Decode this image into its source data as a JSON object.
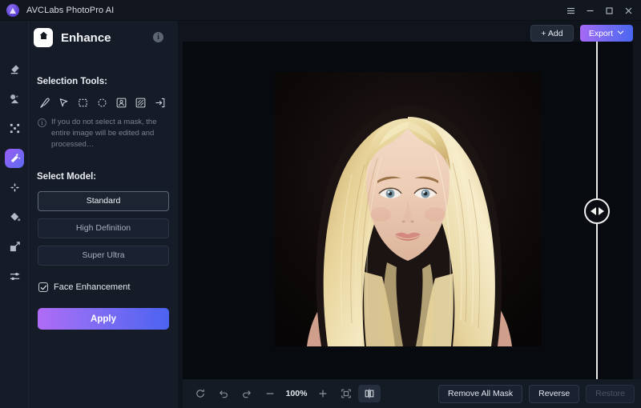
{
  "window": {
    "app_title": "AVCLabs PhotoPro AI",
    "logo_icon": "avclabs-logo",
    "controls": [
      {
        "name": "menu-button",
        "icon": "hamburger-icon"
      },
      {
        "name": "minimize-button",
        "icon": "minimize-icon"
      },
      {
        "name": "maximize-button",
        "icon": "maximize-icon"
      },
      {
        "name": "close-button",
        "icon": "close-icon"
      }
    ]
  },
  "rail": {
    "items": [
      {
        "name": "sidebar-item-erase",
        "icon": "eraser-icon",
        "active": false
      },
      {
        "name": "sidebar-item-background",
        "icon": "background-remove-icon",
        "active": false
      },
      {
        "name": "sidebar-item-upscale",
        "icon": "upscale-icon",
        "active": false
      },
      {
        "name": "sidebar-item-enhance",
        "icon": "magic-wand-icon",
        "active": true
      },
      {
        "name": "sidebar-item-retouch",
        "icon": "retouch-icon",
        "active": false
      },
      {
        "name": "sidebar-item-colorize",
        "icon": "paint-bucket-icon",
        "active": false
      },
      {
        "name": "sidebar-item-expand",
        "icon": "expand-icon",
        "active": false
      },
      {
        "name": "sidebar-item-adjust",
        "icon": "sliders-icon",
        "active": false
      }
    ]
  },
  "panel": {
    "home_icon": "home-icon",
    "title": "Enhance",
    "info_icon": "info-icon",
    "info_glyph": "i",
    "selection_tools_label": "Selection Tools:",
    "tools": [
      {
        "name": "tool-brush",
        "icon": "brush-icon"
      },
      {
        "name": "tool-lasso",
        "icon": "cursor-arrow-icon"
      },
      {
        "name": "tool-rectangle",
        "icon": "rectangle-marquee-icon"
      },
      {
        "name": "tool-ellipse",
        "icon": "ellipse-marquee-icon"
      },
      {
        "name": "tool-portrait-select",
        "icon": "person-select-icon"
      },
      {
        "name": "tool-pattern-select",
        "icon": "hatched-box-icon"
      },
      {
        "name": "tool-import-mask",
        "icon": "arrow-into-box-icon"
      }
    ],
    "hint_icon": "info-circle-icon",
    "hint_glyph": "i",
    "hint_text": "If you do not select a mask, the entire image will be edited and processed…",
    "select_model_label": "Select Model:",
    "models": [
      {
        "label": "Standard",
        "selected": true
      },
      {
        "label": "High Definition",
        "selected": false
      },
      {
        "label": "Super Ultra",
        "selected": false
      }
    ],
    "face_enhancement": {
      "label": "Face Enhancement",
      "checked": true,
      "icon": "checkbox-checked-icon"
    },
    "apply_label": "Apply"
  },
  "top_actions": {
    "add_label": "+ Add",
    "add_icon": "plus-icon",
    "export_label": "Export",
    "export_chevron_icon": "chevron-down-icon"
  },
  "canvas": {
    "divider_handle_icon": "compare-slider-icon",
    "photo_alt": "portrait-of-blonde-woman"
  },
  "bottombar": {
    "tools": [
      {
        "name": "reset-button",
        "icon": "reset-icon",
        "active": false
      },
      {
        "name": "undo-button",
        "icon": "undo-icon",
        "active": false
      },
      {
        "name": "redo-button",
        "icon": "redo-icon",
        "active": false
      },
      {
        "name": "zoom-out-button",
        "icon": "minus-icon",
        "active": false
      }
    ],
    "zoom_value": "100%",
    "tools_after": [
      {
        "name": "zoom-in-button",
        "icon": "plus-icon",
        "active": false
      },
      {
        "name": "fit-to-screen-button",
        "icon": "fit-screen-icon",
        "active": false
      },
      {
        "name": "compare-view-button",
        "icon": "split-view-icon",
        "active": true
      }
    ],
    "actions": [
      {
        "name": "remove-all-mask-button",
        "label": "Remove All Mask",
        "disabled": false
      },
      {
        "name": "reverse-button",
        "label": "Reverse",
        "disabled": false
      },
      {
        "name": "restore-button",
        "label": "Restore",
        "disabled": true
      }
    ]
  },
  "colors": {
    "accent_purple": "#a668f4",
    "accent_blue": "#4a66f0",
    "panel_bg": "#161c27",
    "canvas_bg": "#070a0f",
    "titlebar_bg": "#12161f"
  }
}
